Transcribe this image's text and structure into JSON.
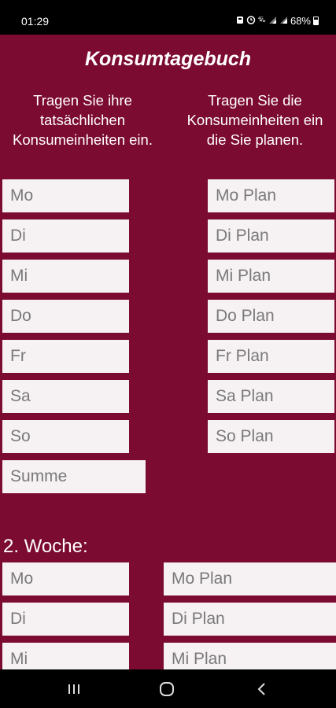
{
  "status": {
    "time": "01:29",
    "battery": "68%"
  },
  "app": {
    "title": "Konsumtagebuch",
    "instruction_left": "Tragen Sie ihre tatsächlichen Konsumeinheiten ein.",
    "instruction_right": "Tragen Sie die Konsumeinheiten ein die Sie planen."
  },
  "week1": {
    "actual": [
      {
        "placeholder": "Mo"
      },
      {
        "placeholder": "Di"
      },
      {
        "placeholder": "Mi"
      },
      {
        "placeholder": "Do"
      },
      {
        "placeholder": "Fr"
      },
      {
        "placeholder": "Sa"
      },
      {
        "placeholder": "So"
      }
    ],
    "plan": [
      {
        "placeholder": "Mo Plan"
      },
      {
        "placeholder": "Di Plan"
      },
      {
        "placeholder": "Mi Plan"
      },
      {
        "placeholder": "Do Plan"
      },
      {
        "placeholder": "Fr Plan"
      },
      {
        "placeholder": "Sa Plan"
      },
      {
        "placeholder": "So Plan"
      }
    ],
    "sum_placeholder": "Summe"
  },
  "week2": {
    "label": "2. Woche:",
    "actual": [
      {
        "placeholder": "Mo"
      },
      {
        "placeholder": "Di"
      },
      {
        "placeholder": "Mi"
      }
    ],
    "plan": [
      {
        "placeholder": "Mo Plan"
      },
      {
        "placeholder": "Di Plan"
      },
      {
        "placeholder": "Mi Plan"
      }
    ]
  },
  "colors": {
    "background": "#7c0b31",
    "field": "#f6f1f3",
    "placeholder_text": "#7a7a7a"
  },
  "icons": [
    "signal-icon",
    "alarm-icon",
    "lte-icon",
    "battery-icon",
    "recents-icon",
    "home-icon",
    "back-icon"
  ]
}
